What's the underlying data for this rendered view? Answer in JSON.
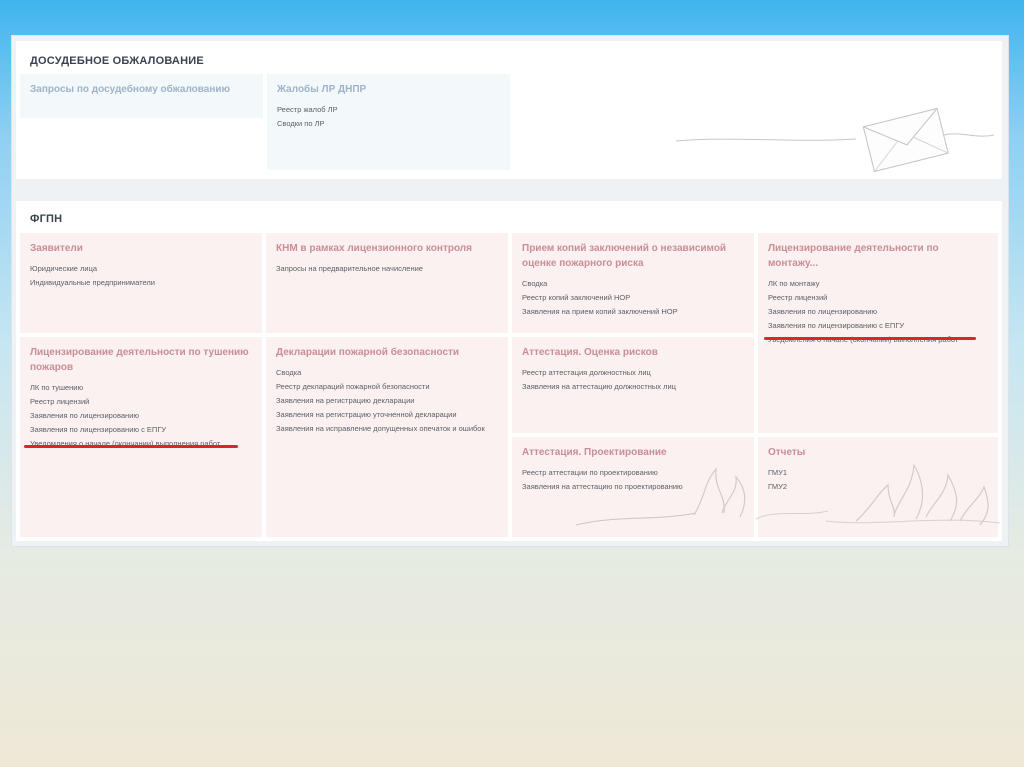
{
  "pre_trial": {
    "title": "ДОСУДЕБНОЕ ОБЖАЛОВАНИЕ",
    "cards": [
      {
        "title": "Запросы по досудебному обжалованию",
        "links": []
      },
      {
        "title": "Жалобы ЛР ДНПР",
        "links": [
          "Реестр жалоб ЛР",
          "Сводки по ЛР"
        ]
      }
    ]
  },
  "fgpn": {
    "title": "ФГПН",
    "cards": [
      {
        "title": "Заявители",
        "links": [
          "Юридические лица",
          "Индивидуальные предприниматели"
        ]
      },
      {
        "title": "КНМ в рамках лицензионного контроля",
        "links": [
          "Запросы на предварительное начисление"
        ]
      },
      {
        "title": "Прием копий заключений о независимой оценке пожарного риска",
        "links": [
          "Сводка",
          "Реестр копий заключений НОР",
          "Заявления на прием копий заключений НОР"
        ]
      },
      {
        "title": "Лицензирование деятельности по монтажу...",
        "links": [
          "ЛК по монтажу",
          "Реестр лицензий",
          "Заявления по лицензированию",
          "Заявления по лицензированию с ЕПГУ",
          "Уведомления о начале (окончании) выполнения работ"
        ]
      },
      {
        "title": "Лицензирование деятельности по тушению пожаров",
        "links": [
          "ЛК по тушению",
          "Реестр лицензий",
          "Заявления по лицензированию",
          "Заявления по лицензированию с ЕПГУ",
          "Уведомления о начале (окончании) выполнения работ"
        ]
      },
      {
        "title": "Декларации пожарной безопасности",
        "links": [
          "Сводка",
          "Реестр деклараций пожарной безопасности",
          "Заявления на регистрацию декларации",
          "Заявления на регистрацию уточненной декларации",
          "Заявления на исправление допущенных опечаток и ошибок"
        ]
      },
      {
        "title": "Аттестация. Оценка рисков",
        "links": [
          "Реестр аттестация должностных лиц",
          "Заявления на аттестацию должностных лиц"
        ]
      },
      {
        "title": "Аттестация. Проектирование",
        "links": [
          "Реестр аттестации по проектированию",
          "Заявления на аттестацию по проектированию"
        ]
      },
      {
        "title": "Отчеты",
        "links": [
          "ГМУ1",
          "ГМУ2"
        ]
      }
    ]
  },
  "colors": {
    "highlight": "#d8262f",
    "card_pink": "#fbf1f1",
    "card_blue": "#f3f8fb"
  },
  "icons": [
    "envelope-icon",
    "flame-decoration"
  ]
}
